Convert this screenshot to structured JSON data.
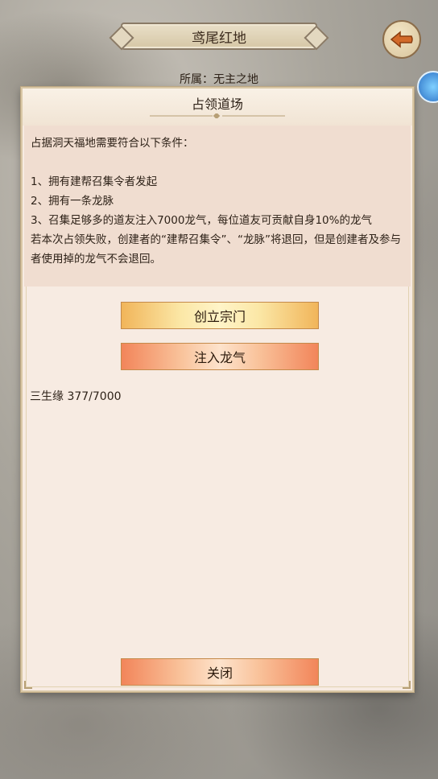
{
  "header": {
    "title": "鸢尾红地",
    "owner_label": "所属：",
    "owner_value": "无主之地"
  },
  "dialog": {
    "title": "占领道场",
    "conditions": "占据洞天福地需要符合以下条件：\n\n1、拥有建帮召集令者发起\n2、拥有一条龙脉\n3、召集足够多的道友注入7000龙气，每位道友可贡献自身10%的龙气\n若本次占领失败，创建者的“建帮召集令”、“龙脉”将退回，但是创建者及参与者使用掉的龙气不会退回。",
    "create_button": "创立宗门",
    "inject_button": "注入龙气",
    "status_name": "三生缘",
    "status_value": "377/7000",
    "close_button": "关闭"
  },
  "icons": {
    "back": "back-arrow-icon",
    "side": "side-orb-icon"
  },
  "colors": {
    "dialog_bg": "#f7ebe2",
    "panel_bg": "#f0ddd0",
    "gold_button": "#fbe7a6",
    "orange_button": "#f9c29a"
  }
}
